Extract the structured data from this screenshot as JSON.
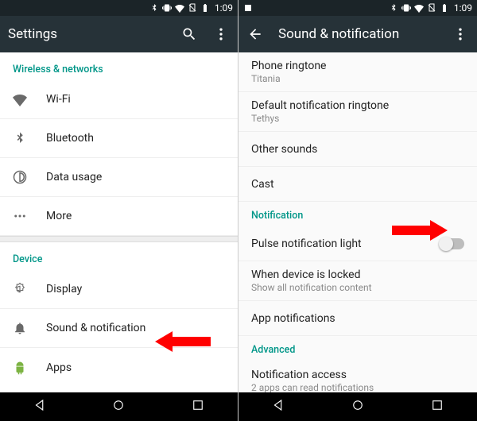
{
  "status": {
    "time": "1:09"
  },
  "left": {
    "title": "Settings",
    "sections": {
      "wireless": "Wireless & networks",
      "device": "Device"
    },
    "items": {
      "wifi": "Wi-Fi",
      "bluetooth": "Bluetooth",
      "data": "Data usage",
      "more": "More",
      "display": "Display",
      "sound": "Sound & notification",
      "apps": "Apps"
    }
  },
  "right": {
    "title": "Sound & notification",
    "ringtone": {
      "label": "Phone ringtone",
      "value": "Titania"
    },
    "notif_ringtone": {
      "label": "Default notification ringtone",
      "value": "Tethys"
    },
    "other_sounds": "Other sounds",
    "cast": "Cast",
    "section_notif": "Notification",
    "pulse": "Pulse notification light",
    "locked": {
      "label": "When device is locked",
      "value": "Show all notification content"
    },
    "app_notif": "App notifications",
    "section_adv": "Advanced",
    "notif_access": {
      "label": "Notification access",
      "value": "2 apps can read notifications"
    }
  }
}
